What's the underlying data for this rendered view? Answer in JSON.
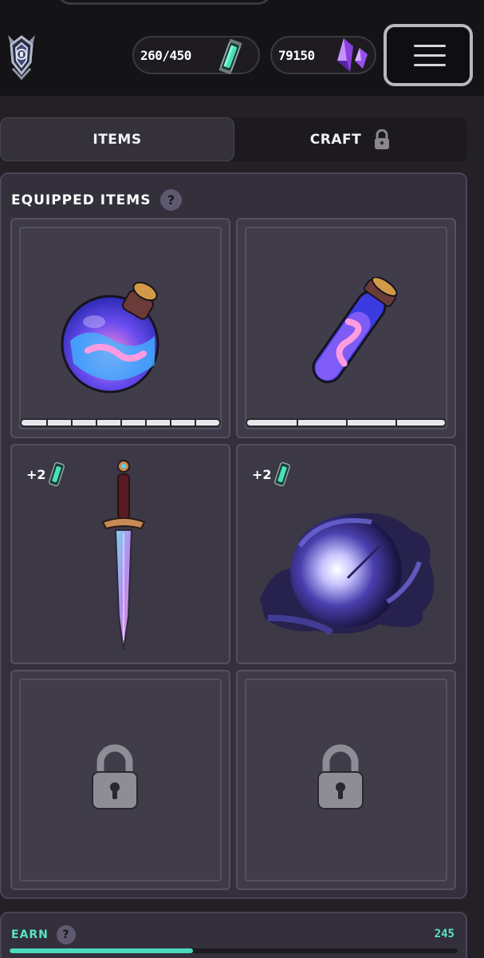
{
  "header": {
    "logo_icon": "shield-emblem-icon",
    "energy": {
      "value": "260/450",
      "icon": "energy-cell-icon"
    },
    "gems": {
      "value": "79150",
      "icon": "crystal-icon"
    },
    "menu_icon": "hamburger-menu-icon"
  },
  "tabs": [
    {
      "label": "ITEMS",
      "active": true,
      "locked": false
    },
    {
      "label": "CRAFT",
      "active": false,
      "locked": true
    }
  ],
  "equipped": {
    "title": "EQUIPPED ITEMS",
    "help_label": "?",
    "slots": [
      {
        "item": "round-potion",
        "durability_segments": 8,
        "bonus": null
      },
      {
        "item": "vial-potion",
        "durability_segments": 4,
        "bonus": null
      },
      {
        "item": "dagger",
        "bonus": "+2"
      },
      {
        "item": "shadow-orb",
        "bonus": "+2"
      },
      {
        "item": null,
        "locked": true
      },
      {
        "item": null,
        "locked": true
      }
    ]
  },
  "earn": {
    "label": "EARN",
    "help_label": "?",
    "amount": "245",
    "progress": 0.41
  },
  "colors": {
    "accent": "#58e5c8",
    "background": "#232026",
    "panel": "#332f3b",
    "crystal": "#a35cf0"
  }
}
